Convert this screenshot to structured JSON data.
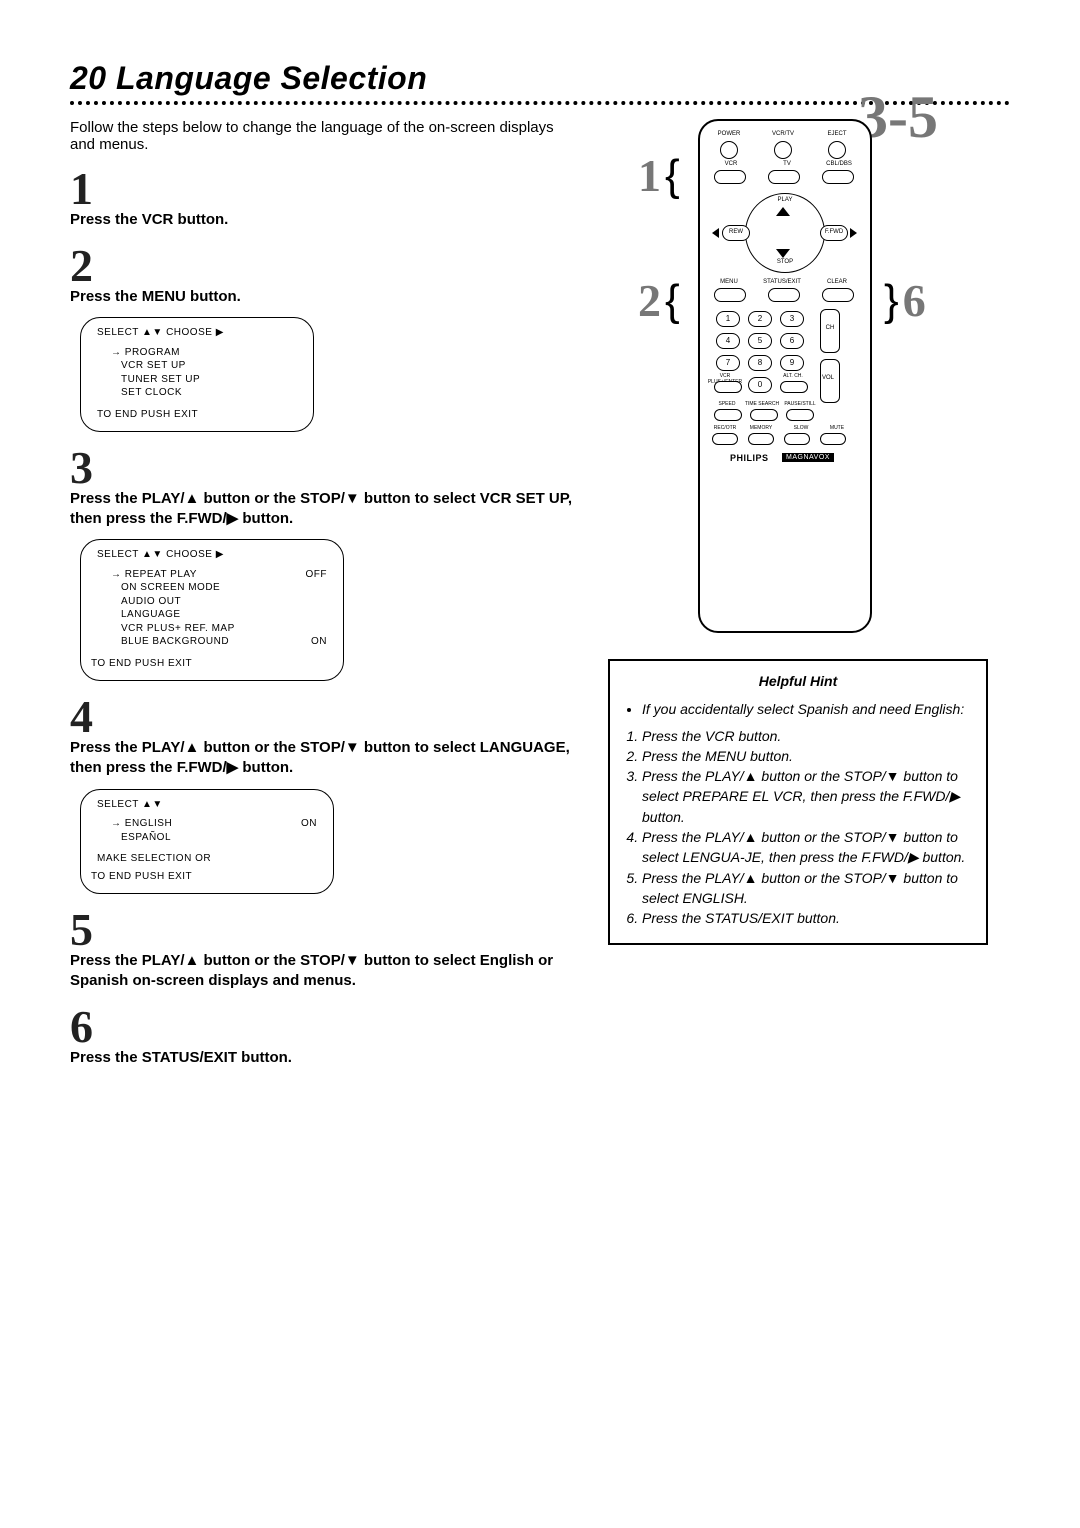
{
  "page": {
    "number": "20",
    "title": "Language Selection",
    "intro": "Follow the steps below to change the language of the on-screen displays and menus."
  },
  "steps": {
    "s1": {
      "num": "1",
      "text": "Press the VCR button."
    },
    "s2": {
      "num": "2",
      "text": "Press the MENU button."
    },
    "s3": {
      "num": "3",
      "text_a": "Press the PLAY/▲ button or the STOP/▼ button to select VCR SET UP, then press the F.FWD/▶ button."
    },
    "s4": {
      "num": "4",
      "text_a": "Press the PLAY/▲ button or the STOP/▼ button to select LANGUAGE, then press the F.FWD/▶ button."
    },
    "s5": {
      "num": "5",
      "text_a": "Press the PLAY/▲ button or the STOP/▼ button to select English or Spanish on-screen displays and menus."
    },
    "s6": {
      "num": "6",
      "text": "Press the STATUS/EXIT button."
    }
  },
  "menu1": {
    "head": "SELECT ▲▼ CHOOSE ▶",
    "i1": "→ PROGRAM",
    "i2": "VCR SET UP",
    "i3": "TUNER SET UP",
    "i4": "SET CLOCK",
    "footer": "TO END PUSH EXIT"
  },
  "menu2": {
    "head": "SELECT ▲▼ CHOOSE ▶",
    "i1": "→ REPEAT PLAY",
    "v1": "OFF",
    "i2": "ON SCREEN MODE",
    "i3": "AUDIO OUT",
    "i4": "LANGUAGE",
    "i5": "VCR PLUS+ REF. MAP",
    "i6": "BLUE BACKGROUND",
    "v6": "ON",
    "footer": "TO END PUSH EXIT"
  },
  "menu3": {
    "head": "SELECT ▲▼",
    "i1": "→ ENGLISH",
    "v1": "ON",
    "i2": "ESPAÑOL",
    "footer1": "MAKE SELECTION OR",
    "footer2": "TO END PUSH EXIT"
  },
  "callouts": {
    "c1": "1",
    "c2": "2",
    "c35": "3-5",
    "c6": "6"
  },
  "remote": {
    "power": "POWER",
    "vcrtv": "VCR/TV",
    "eject": "EJECT",
    "vcr": "VCR",
    "tv": "TV",
    "cbldbs": "CBL/DBS",
    "play": "PLAY",
    "rew": "REW",
    "stop": "STOP",
    "ffwd": "F.FWD",
    "menu": "MENU",
    "statusexit": "STATUS/EXIT",
    "clear": "CLEAR",
    "n1": "1",
    "n2": "2",
    "n3": "3",
    "n4": "4",
    "n5": "5",
    "n6": "6",
    "n7": "7",
    "n8": "8",
    "n9": "9",
    "n0": "0",
    "vcrplus": "VCR PLUS+/ENTER",
    "altch": "ALT. CH.",
    "ch": "CH",
    "vol": "VOL",
    "speed": "SPEED",
    "timesearch": "TIME SEARCH",
    "pausestill": "PAUSE/STILL",
    "recotr": "REC/OTR",
    "memory": "MEMORY",
    "slow": "SLOW",
    "mute": "MUTE",
    "brand1": "PHILIPS",
    "brand2": "MAGNAVOX"
  },
  "hint": {
    "title": "Helpful Hint",
    "lead": "If you accidentally select Spanish and need English:",
    "h1": "Press the VCR button.",
    "h2": "Press the MENU button.",
    "h3": "Press the PLAY/▲ button or the STOP/▼ button to select PREPARE EL VCR, then press the F.FWD/▶ button.",
    "h4": "Press the PLAY/▲ button or the STOP/▼ button to select LENGUA-JE, then press the F.FWD/▶ button.",
    "h5": "Press the PLAY/▲ button or the STOP/▼ button to select ENGLISH.",
    "h6": "Press the STATUS/EXIT button."
  }
}
